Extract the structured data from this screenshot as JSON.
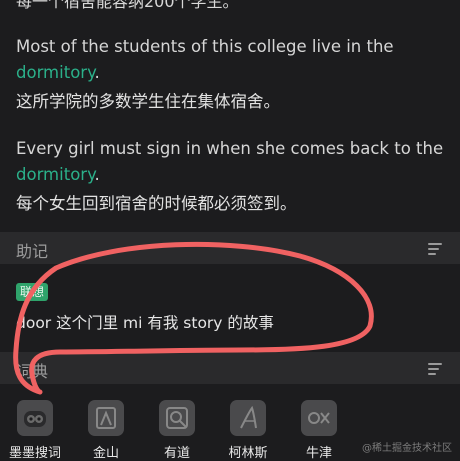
{
  "top_cut_text": "每一个宿舍能容纳200个学生。",
  "examples": [
    {
      "en_before": "Most of the students of this college live in the ",
      "word": "dormitory",
      "en_after": ".",
      "zh": "这所学院的多数学生住在集体宿舍。"
    },
    {
      "en_before": "Every girl must sign in when she comes back to the ",
      "word": "dormitory",
      "en_after": ".",
      "zh": "每个女生回到宿舍的时候都必须签到。"
    }
  ],
  "mnemonic_section": {
    "title": "助记",
    "sort_icon": "sort-lines-icon"
  },
  "mnemonic": {
    "tag": "联想",
    "text": "door 这个门里 mi 有我 story 的故事"
  },
  "dictionary_section": {
    "title": "词典",
    "sort_icon": "sort-lines-icon"
  },
  "dictionaries": [
    {
      "label": "墨墨搜词",
      "icon": "owl-icon"
    },
    {
      "label": "金山",
      "icon": "jinshan-icon"
    },
    {
      "label": "有道",
      "icon": "youdao-icon"
    },
    {
      "label": "柯林斯",
      "icon": "collins-icon"
    },
    {
      "label": "牛津",
      "icon": "oxford-icon"
    }
  ],
  "watermark": "@稀土掘金技术社区",
  "colors": {
    "accent": "#2bb08a",
    "tag_bg": "#2fa36b",
    "annotation": "#f06262",
    "background": "#1c1c1e",
    "section_bg": "#2a2a2c"
  }
}
